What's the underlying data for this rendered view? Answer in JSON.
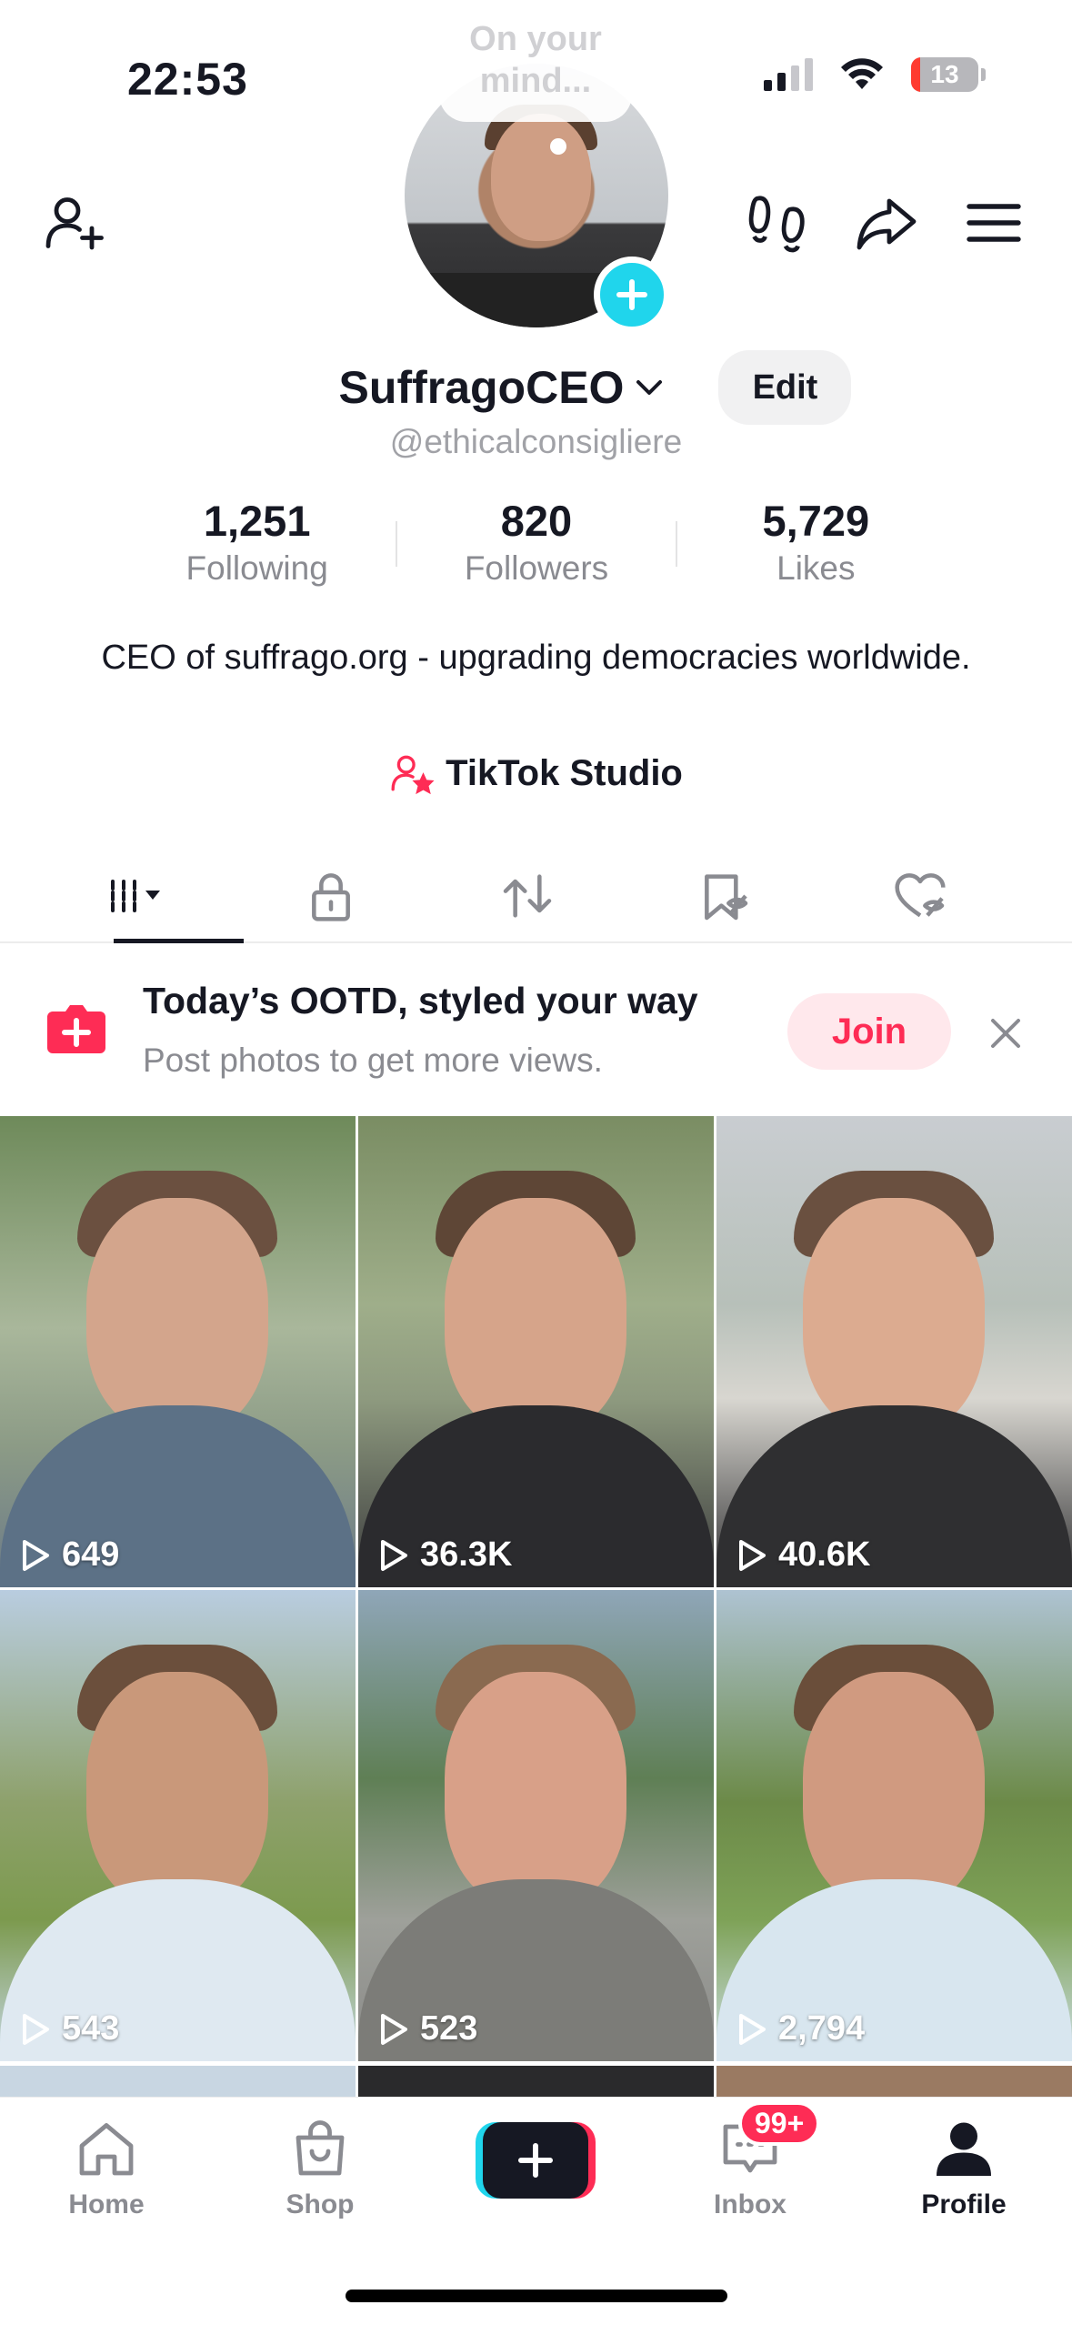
{
  "status": {
    "time": "22:53",
    "battery": "13",
    "battery_color": "#ff3b30"
  },
  "avatar": {
    "note_bubble": "On your mind..."
  },
  "profile": {
    "username": "SuffragoCEO",
    "handle": "@ethicalconsigliere",
    "edit_label": "Edit",
    "stats": [
      {
        "value": "1,251",
        "label": "Following"
      },
      {
        "value": "820",
        "label": "Followers"
      },
      {
        "value": "5,729",
        "label": "Likes"
      }
    ],
    "bio": "CEO of suffrago.org - upgrading democracies worldwide.",
    "studio_label": "TikTok Studio"
  },
  "tabs": [
    "videos-grid-icon",
    "lock-icon",
    "repost-icon",
    "favorites-icon",
    "liked-icon"
  ],
  "banner": {
    "title": "Today’s OOTD, styled your way",
    "subtitle": "Post photos to get more views.",
    "join_label": "Join"
  },
  "videos": [
    {
      "views": "649"
    },
    {
      "views": "36.3K"
    },
    {
      "views": "40.6K"
    },
    {
      "views": "543"
    },
    {
      "views": "523"
    },
    {
      "views": "2,794"
    }
  ],
  "nav": {
    "home": "Home",
    "shop": "Shop",
    "inbox": "Inbox",
    "inbox_badge": "99+",
    "profile": "Profile"
  },
  "colors": {
    "accent": "#fe2c55",
    "cyan": "#20d5ec",
    "text": "#161823",
    "muted": "#8a8b91"
  }
}
